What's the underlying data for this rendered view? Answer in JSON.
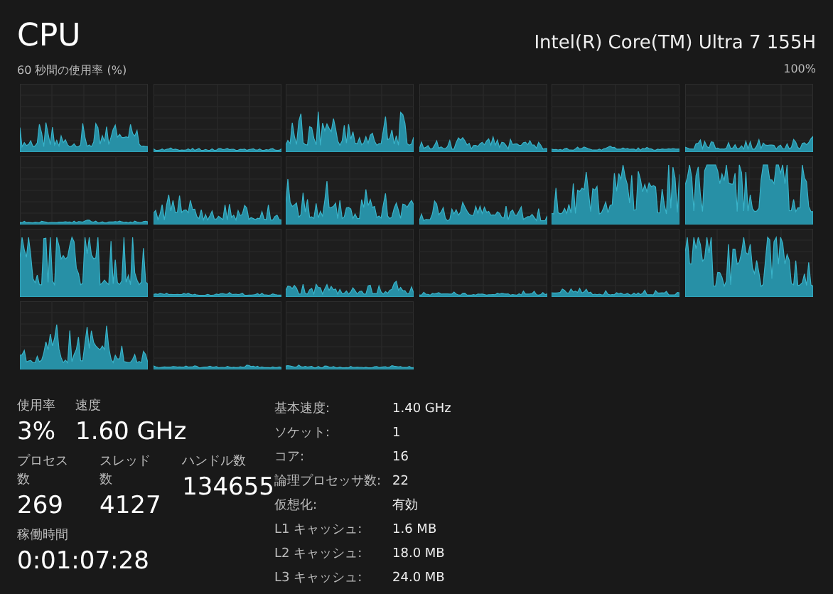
{
  "header": {
    "title": "CPU",
    "model": "Intel(R) Core(TM) Ultra 7 155H"
  },
  "graph_area": {
    "caption": "60 秒間の使用率 (%)",
    "max_label": "100%"
  },
  "stats": [
    [
      {
        "label": "使用率",
        "value": "3%"
      },
      {
        "label": "速度",
        "value": "1.60 GHz"
      }
    ],
    [
      {
        "label": "プロセス数",
        "value": "269"
      },
      {
        "label": "スレッド数",
        "value": "4127"
      },
      {
        "label": "ハンドル数",
        "value": "134655"
      }
    ],
    [
      {
        "label": "稼働時間",
        "value": "0:01:07:28"
      }
    ]
  ],
  "details": [
    {
      "label": "基本速度:",
      "value": "1.40 GHz"
    },
    {
      "label": "ソケット:",
      "value": "1"
    },
    {
      "label": "コア:",
      "value": "16"
    },
    {
      "label": "論理プロセッサ数:",
      "value": "22"
    },
    {
      "label": "仮想化:",
      "value": "有効"
    },
    {
      "label": "L1 キャッシュ:",
      "value": "1.6 MB"
    },
    {
      "label": "L2 キャッシュ:",
      "value": "18.0 MB"
    },
    {
      "label": "L3 キャッシュ:",
      "value": "24.0 MB"
    }
  ]
}
